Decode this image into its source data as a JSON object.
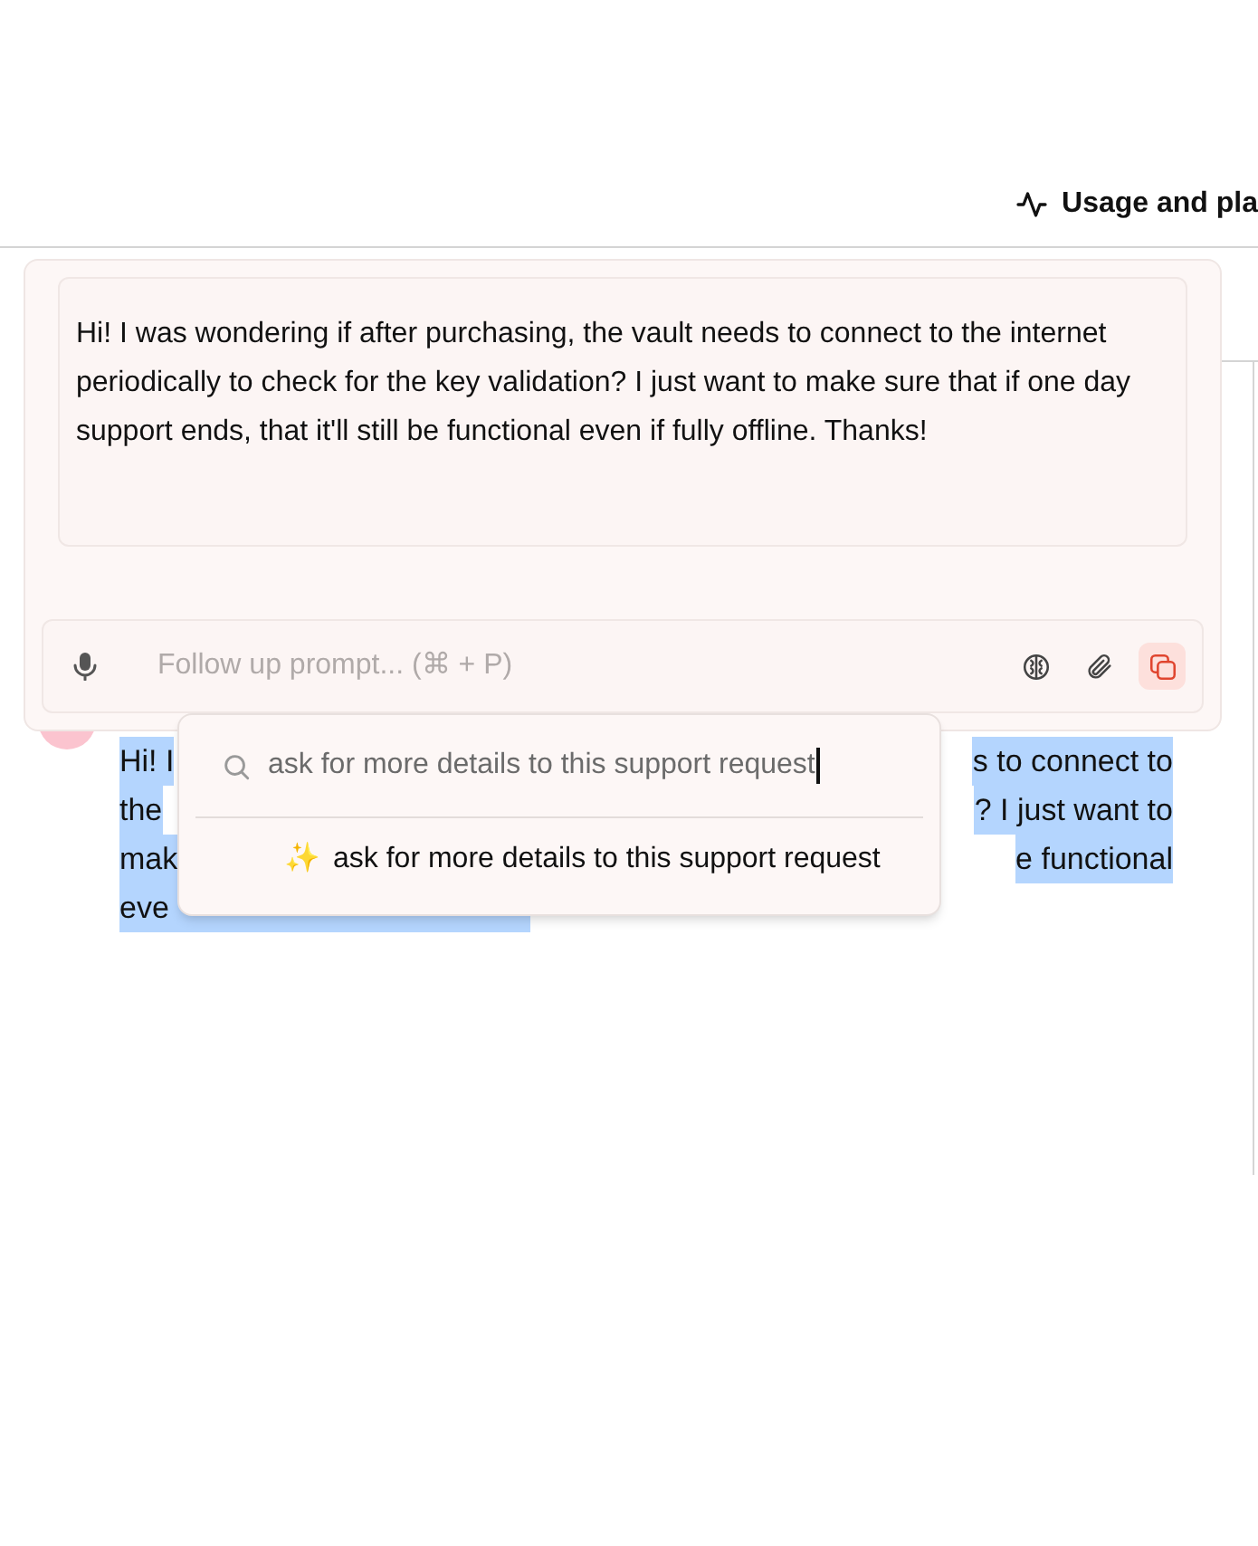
{
  "header": {
    "title": "Usage and pla"
  },
  "background_message": {
    "lines": [
      {
        "left": "Hi! I",
        "right": "s to connect to"
      },
      {
        "left": "the",
        "right": "? I just want to"
      },
      {
        "left": "mak",
        "right": "e functional"
      },
      {
        "left": "eve"
      }
    ]
  },
  "composer": {
    "message": "Hi! I was wondering if after purchasing, the vault needs to connect to the internet periodically to check for the key validation? I just want to make sure that if one day support ends, that it'll still be functional even if fully offline. Thanks!",
    "follow_up": {
      "placeholder": "Follow up prompt... (⌘ + P)"
    },
    "tools": [
      {
        "kind": "brain",
        "selected": false
      },
      {
        "kind": "attach",
        "selected": false
      },
      {
        "kind": "copy",
        "selected": true
      }
    ]
  },
  "popup": {
    "search": {
      "value": "ask for more details to this support request"
    },
    "suggestions": [
      {
        "icon": "✨",
        "label": "ask for more details to this support request"
      }
    ]
  }
}
